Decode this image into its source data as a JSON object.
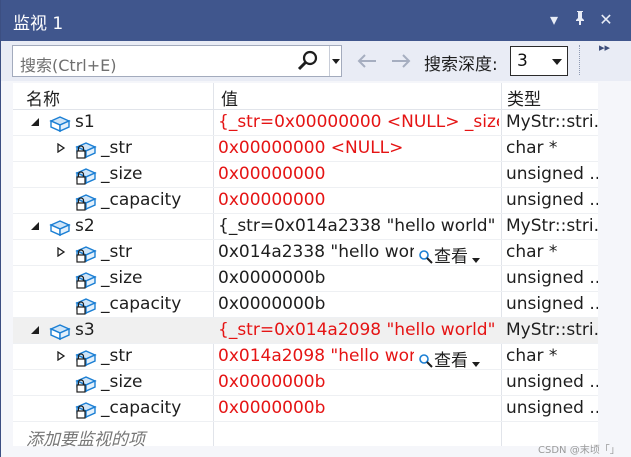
{
  "window": {
    "title": "监视 1",
    "buttons": {
      "dropdown": "▾",
      "pin": "⊥",
      "close": "✕"
    }
  },
  "toolbar": {
    "search_placeholder": "搜索(Ctrl+E)",
    "depth_label": "搜索深度:",
    "depth_value": "3"
  },
  "columns": {
    "name": "名称",
    "value": "值",
    "type": "类型"
  },
  "rows": [
    {
      "name": "s1",
      "value": "{_str=0x00000000 <NULL> _size=...",
      "type": "MyStr::stri...",
      "level": 0,
      "expander": "expanded",
      "changed": true
    },
    {
      "name": "_str",
      "value": "0x00000000 <NULL>",
      "type": "char *",
      "level": 1,
      "expander": "collapsed",
      "changed": true
    },
    {
      "name": "_size",
      "value": "0x00000000",
      "type": "unsigned ...",
      "level": 1,
      "expander": "none",
      "changed": true
    },
    {
      "name": "_capacity",
      "value": "0x00000000",
      "type": "unsigned ...",
      "level": 1,
      "expander": "none",
      "changed": true
    },
    {
      "name": "s2",
      "value": "{_str=0x014a2338 \"hello world\" _s...",
      "type": "MyStr::stri...",
      "level": 0,
      "expander": "expanded",
      "changed": false
    },
    {
      "name": "_str",
      "value": "0x014a2338 \"hello worl...",
      "type": "char *",
      "level": 1,
      "expander": "collapsed",
      "changed": false,
      "viewer": "查看"
    },
    {
      "name": "_size",
      "value": "0x0000000b",
      "type": "unsigned ...",
      "level": 1,
      "expander": "none",
      "changed": false
    },
    {
      "name": "_capacity",
      "value": "0x0000000b",
      "type": "unsigned ...",
      "level": 1,
      "expander": "none",
      "changed": false
    },
    {
      "name": "s3",
      "value": "{_str=0x014a2098 \"hello world\" _s...",
      "type": "MyStr::stri...",
      "level": 0,
      "expander": "expanded",
      "changed": true,
      "selected": true
    },
    {
      "name": "_str",
      "value": "0x014a2098 \"hello worl...",
      "type": "char *",
      "level": 1,
      "expander": "collapsed",
      "changed": true,
      "viewer": "查看"
    },
    {
      "name": "_size",
      "value": "0x0000000b",
      "type": "unsigned ...",
      "level": 1,
      "expander": "none",
      "changed": true
    },
    {
      "name": "_capacity",
      "value": "0x0000000b",
      "type": "unsigned ...",
      "level": 1,
      "expander": "none",
      "changed": true
    }
  ],
  "add_watch_placeholder": "添加要监视的项",
  "watermark": "CSDN @末顷「」",
  "colors": {
    "title_bg": "#40568d",
    "changed_value": "#e51414",
    "icon_blue": "#1b7fd4"
  }
}
